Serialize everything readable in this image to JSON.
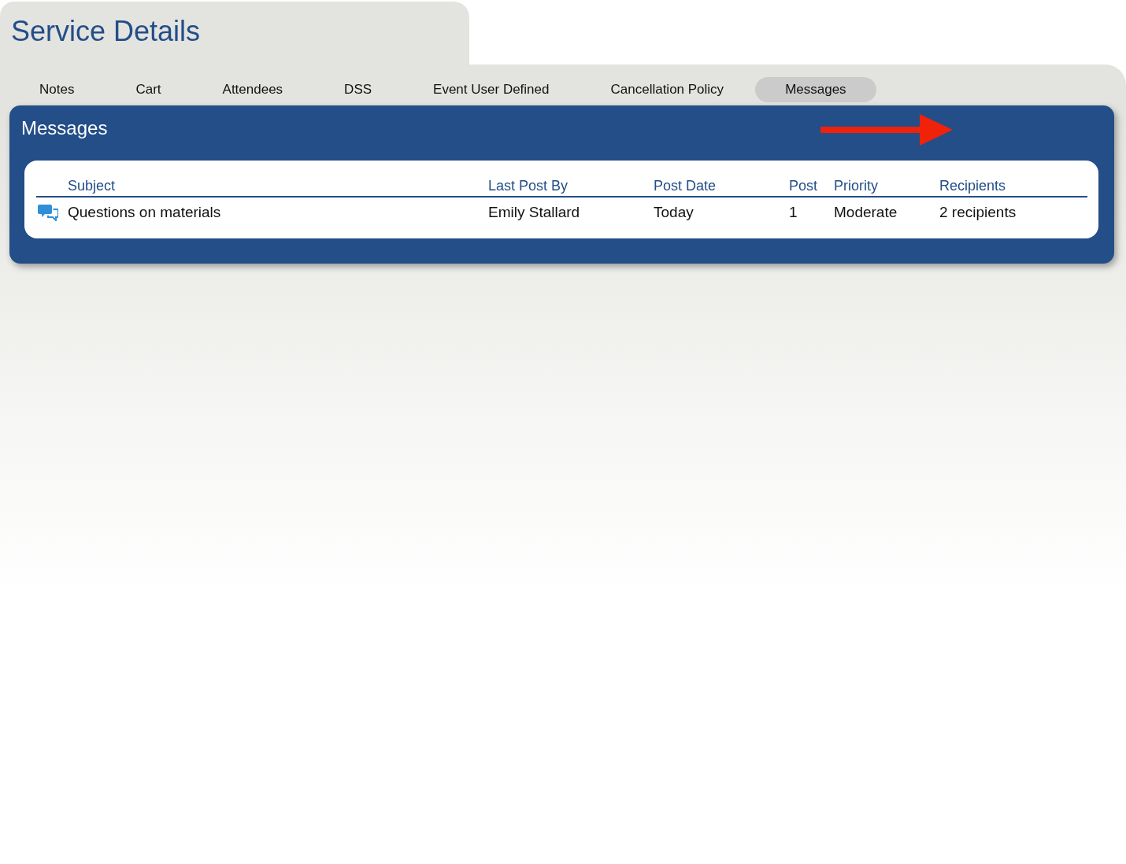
{
  "page": {
    "title": "Service Details"
  },
  "tabs": [
    {
      "label": "Notes",
      "selected": false
    },
    {
      "label": "Cart",
      "selected": false
    },
    {
      "label": "Attendees",
      "selected": false
    },
    {
      "label": "DSS",
      "selected": false
    },
    {
      "label": "Event User Defined",
      "selected": false
    },
    {
      "label": "Cancellation Policy",
      "selected": false
    },
    {
      "label": "Messages",
      "selected": true
    }
  ],
  "messages_panel": {
    "title": "Messages",
    "table": {
      "columns": [
        "Subject",
        "Last Post By",
        "Post Date",
        "Post",
        "Priority",
        "Recipients"
      ],
      "rows": [
        {
          "cells": [
            "Questions on materials",
            "Emily Stallard",
            "Today",
            "1",
            "Moderate",
            "2 recipients"
          ]
        }
      ]
    }
  }
}
